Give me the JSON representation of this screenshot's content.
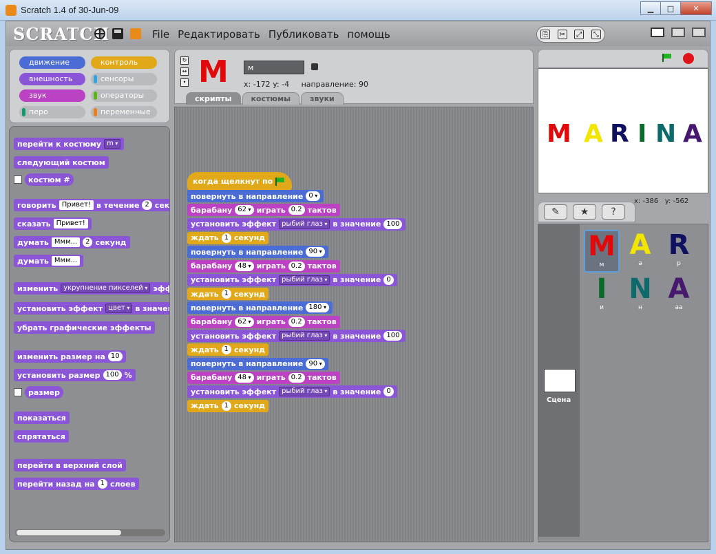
{
  "window": {
    "title": "Scratch 1.4 of 30-Jun-09",
    "minimize": "▁",
    "maximize": "□",
    "close": "✕"
  },
  "menubar": {
    "logo": "SCRATCH",
    "items": [
      "File",
      "Редактировать",
      "Публиковать",
      "помощь"
    ]
  },
  "categories": {
    "motion": "движение",
    "control": "контроль",
    "looks": "внешность",
    "sensing": "сенсоры",
    "sound": "звук",
    "operators": "операторы",
    "pen": "перо",
    "variables": "переменные"
  },
  "palette": {
    "switch_costume": "перейти к костюму",
    "switch_costume_val": "m",
    "next_costume": "следующий костюм",
    "costume_num": "костюм #",
    "say_for": "говорить",
    "say_for_text": "Привет!",
    "say_for_mid": "в течение",
    "say_for_secs": "2",
    "say_for_unit": "секунд",
    "say": "сказать",
    "say_text": "Привет!",
    "think_for": "думать",
    "think_for_text": "Ммм...",
    "think_for_secs": "2",
    "think_for_unit": "секунд",
    "think": "думать",
    "think_text": "Ммм...",
    "change_effect": "изменить",
    "change_effect_val": "укрупнение пикселей",
    "change_effect_end": "эфф",
    "set_effect": "установить эффект",
    "set_effect_val": "цвет",
    "set_effect_end": "в значени",
    "clear_effects": "убрать графические эффекты",
    "change_size": "изменить размер на",
    "change_size_val": "10",
    "set_size": "установить размер",
    "set_size_val": "100",
    "set_size_unit": "%",
    "size": "размер",
    "show": "показаться",
    "hide": "спрятаться",
    "front": "перейти в верхний слой",
    "back": "перейти назад на",
    "back_val": "1",
    "back_unit": "слоев"
  },
  "sprite": {
    "name": "м",
    "x_label": "x:",
    "x": "-172",
    "y_label": "y:",
    "y": "-4",
    "dir_label": "направление:",
    "dir": "90"
  },
  "tabs": [
    "скрипты",
    "костюмы",
    "звуки"
  ],
  "script": {
    "hat": "когда щелкнут по",
    "point_dir": "повернуть в направление",
    "drum": "барабану",
    "play": "играть",
    "beats": "тактов",
    "set_effect": "установить эффект",
    "effect": "рыбий глаз",
    "to_value": "в значение",
    "wait": "ждать",
    "secs": "секунд",
    "rows": [
      {
        "type": "point",
        "v": "0"
      },
      {
        "type": "drum",
        "v": "62",
        "b": "0.2"
      },
      {
        "type": "effect",
        "v": "100"
      },
      {
        "type": "wait",
        "v": "1"
      },
      {
        "type": "point",
        "v": "90"
      },
      {
        "type": "drum",
        "v": "48",
        "b": "0.2"
      },
      {
        "type": "effect",
        "v": "0"
      },
      {
        "type": "wait",
        "v": "1"
      },
      {
        "type": "point",
        "v": "180"
      },
      {
        "type": "drum",
        "v": "62",
        "b": "0.2"
      },
      {
        "type": "effect",
        "v": "100"
      },
      {
        "type": "wait",
        "v": "1"
      },
      {
        "type": "point",
        "v": "90"
      },
      {
        "type": "drum",
        "v": "48",
        "b": "0.2"
      },
      {
        "type": "effect",
        "v": "0"
      },
      {
        "type": "wait",
        "v": "1"
      }
    ]
  },
  "stage": {
    "letters": [
      {
        "ch": "M",
        "color": "#e10909"
      },
      {
        "ch": "A",
        "color": "#f2e600"
      },
      {
        "ch": "R",
        "color": "#101060"
      },
      {
        "ch": "I",
        "color": "#0b6b2a"
      },
      {
        "ch": "N",
        "color": "#0d6a6a"
      },
      {
        "ch": "A",
        "color": "#46196f"
      }
    ],
    "mouse_x_label": "x:",
    "mouse_x": "-386",
    "mouse_y_label": "y:",
    "mouse_y": "-562"
  },
  "sprites": [
    {
      "glyph": "M",
      "name": "м",
      "color": "#e10909"
    },
    {
      "glyph": "A",
      "name": "а",
      "color": "#f2e600"
    },
    {
      "glyph": "R",
      "name": "р",
      "color": "#101060"
    },
    {
      "glyph": "I",
      "name": "и",
      "color": "#0b6b2a"
    },
    {
      "glyph": "N",
      "name": "н",
      "color": "#0d6a6a"
    },
    {
      "glyph": "A",
      "name": "аа",
      "color": "#46196f"
    }
  ],
  "stage_label": "Сцена"
}
